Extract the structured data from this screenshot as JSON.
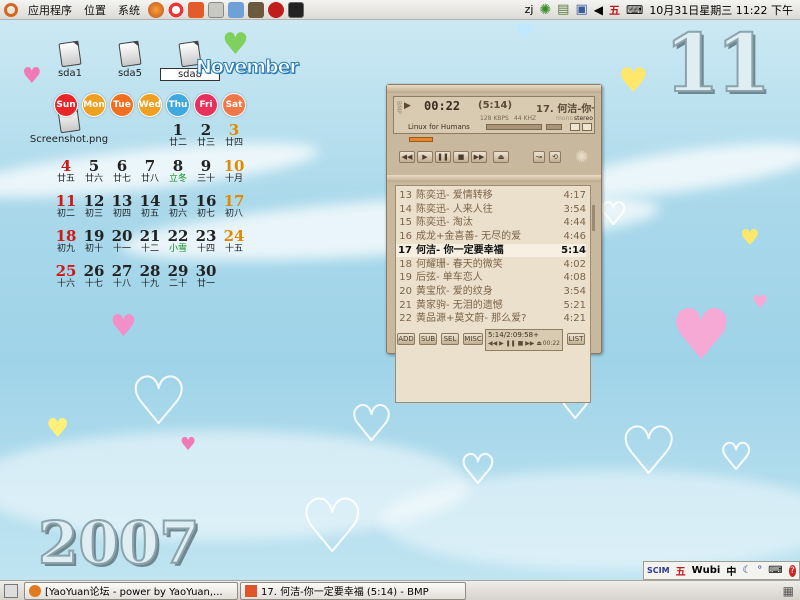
{
  "panel": {
    "menus": [
      "应用程序",
      "位置",
      "系统"
    ],
    "user": "zj",
    "ime_indicator": "五",
    "clock": "10月31日星期三 11:22 下午"
  },
  "desktop_icons": [
    {
      "label": "sda1",
      "selected": false
    },
    {
      "label": "sda5",
      "selected": false
    },
    {
      "label": "sda8",
      "selected": true
    },
    {
      "label": "Screenshot.png",
      "selected": false
    }
  ],
  "calendar": {
    "month": "November",
    "month_number": "11",
    "year": "2007",
    "weekdays": [
      "Sun",
      "Mon",
      "Tue",
      "Wed",
      "Thu",
      "Fri",
      "Sat"
    ],
    "weekday_colors": [
      "#e8262a",
      "#f0a020",
      "#f07020",
      "#f0a020",
      "#3fa8e0",
      "#e8305c",
      "#f07848"
    ],
    "weeks": [
      [
        null,
        null,
        null,
        null,
        {
          "d": "1",
          "s": "廿二"
        },
        {
          "d": "2",
          "s": "廿三"
        },
        {
          "d": "3",
          "s": "廿四"
        }
      ],
      [
        {
          "d": "4",
          "s": "廿五"
        },
        {
          "d": "5",
          "s": "廿六"
        },
        {
          "d": "6",
          "s": "廿七"
        },
        {
          "d": "7",
          "s": "廿八"
        },
        {
          "d": "8",
          "s": "立冬"
        },
        {
          "d": "9",
          "s": "三十"
        },
        {
          "d": "10",
          "s": "十月"
        }
      ],
      [
        {
          "d": "11",
          "s": "初二"
        },
        {
          "d": "12",
          "s": "初三"
        },
        {
          "d": "13",
          "s": "初四"
        },
        {
          "d": "14",
          "s": "初五"
        },
        {
          "d": "15",
          "s": "初六"
        },
        {
          "d": "16",
          "s": "初七"
        },
        {
          "d": "17",
          "s": "初八"
        }
      ],
      [
        {
          "d": "18",
          "s": "初九"
        },
        {
          "d": "19",
          "s": "初十"
        },
        {
          "d": "20",
          "s": "十一"
        },
        {
          "d": "21",
          "s": "十二"
        },
        {
          "d": "22",
          "s": "小雪"
        },
        {
          "d": "23",
          "s": "十四"
        },
        {
          "d": "24",
          "s": "十五"
        }
      ],
      [
        {
          "d": "25",
          "s": "十六"
        },
        {
          "d": "26",
          "s": "十七"
        },
        {
          "d": "27",
          "s": "十八"
        },
        {
          "d": "28",
          "s": "十九"
        },
        {
          "d": "29",
          "s": "二十"
        },
        {
          "d": "30",
          "s": "廿一"
        },
        null
      ]
    ]
  },
  "player": {
    "time": "00:22",
    "track_length": "(5:14)",
    "title": "17. 何洁-你一",
    "bitrate": "128 KBPS",
    "khz": "44 KHZ",
    "mode": "mono",
    "stereo": "stereo",
    "tagline": "Linux for Humans",
    "side_label": "BMP",
    "status": "5:14/2:09:58+",
    "status_time": "00:22",
    "buttons": [
      "ADD",
      "SUB",
      "SEL",
      "MISC",
      "LIST"
    ],
    "playlist": [
      {
        "no": "13",
        "title": "陈奕迅- 爱情转移",
        "dur": "4:17"
      },
      {
        "no": "14",
        "title": "陈奕迅- 人来人往",
        "dur": "3:54"
      },
      {
        "no": "15",
        "title": "陈奕迅- 淘汰",
        "dur": "4:44"
      },
      {
        "no": "16",
        "title": "成龙+金喜善- 无尽的爱",
        "dur": "4:46"
      },
      {
        "no": "17",
        "title": "何洁- 你一定要幸福",
        "dur": "5:14",
        "current": true
      },
      {
        "no": "18",
        "title": "何耀珊- 春天的微笑",
        "dur": "4:02"
      },
      {
        "no": "19",
        "title": "后弦- 单车恋人",
        "dur": "4:08"
      },
      {
        "no": "20",
        "title": "黄宝欣- 爱的纹身",
        "dur": "3:54"
      },
      {
        "no": "21",
        "title": "黄家驹- 无泪的遗憾",
        "dur": "5:21"
      },
      {
        "no": "22",
        "title": "黄品源+莫文蔚- 那么爱?",
        "dur": "4:21"
      }
    ]
  },
  "taskbar": {
    "tasks": [
      {
        "label": "[YaoYuan论坛 - power by YaoYuan,..."
      },
      {
        "label": "17. 何洁-你一定要幸福 (5:14) - BMP"
      }
    ]
  },
  "ime": {
    "logo": "SCIM",
    "mode": "五",
    "method": "Wubi",
    "lang": "中"
  }
}
